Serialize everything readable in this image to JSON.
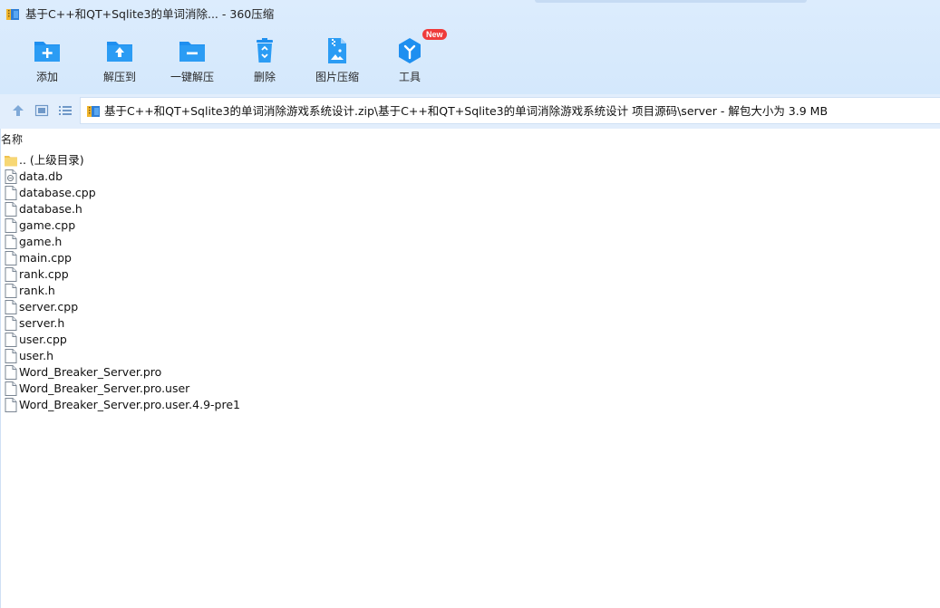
{
  "window": {
    "title": "基于C++和QT+Sqlite3的单词消除... - 360压缩"
  },
  "toolbar": {
    "items": [
      {
        "label": "添加",
        "icon": "add-folder-icon"
      },
      {
        "label": "解压到",
        "icon": "extract-to-folder-icon"
      },
      {
        "label": "一键解压",
        "icon": "one-click-extract-icon"
      },
      {
        "label": "删除",
        "icon": "recycle-bin-icon"
      },
      {
        "label": "图片压缩",
        "icon": "image-compress-icon"
      },
      {
        "label": "工具",
        "icon": "tools-icon",
        "badge": "New"
      }
    ]
  },
  "address": {
    "path": "基于C++和QT+Sqlite3的单词消除游戏系统设计.zip\\基于C++和QT+Sqlite3的单词消除游戏系统设计 项目源码\\server - 解包大小为 3.9 MB"
  },
  "list": {
    "column_name": "名称",
    "files": [
      {
        "name": ".. (上级目录)",
        "type": "folder-up"
      },
      {
        "name": "data.db",
        "type": "db"
      },
      {
        "name": "database.cpp",
        "type": "file"
      },
      {
        "name": "database.h",
        "type": "file"
      },
      {
        "name": "game.cpp",
        "type": "file"
      },
      {
        "name": "game.h",
        "type": "file"
      },
      {
        "name": "main.cpp",
        "type": "file"
      },
      {
        "name": "rank.cpp",
        "type": "file"
      },
      {
        "name": "rank.h",
        "type": "file"
      },
      {
        "name": "server.cpp",
        "type": "file"
      },
      {
        "name": "server.h",
        "type": "file"
      },
      {
        "name": "user.cpp",
        "type": "file"
      },
      {
        "name": "user.h",
        "type": "file"
      },
      {
        "name": "Word_Breaker_Server.pro",
        "type": "file"
      },
      {
        "name": "Word_Breaker_Server.pro.user",
        "type": "file"
      },
      {
        "name": "Word_Breaker_Server.pro.user.4.9-pre1",
        "type": "file"
      }
    ]
  },
  "colors": {
    "accent_blue": "#1e8ff0",
    "chrome_bg": "#dcecfd",
    "badge_red": "#ef3b3b",
    "folder_yellow": "#f7d774"
  }
}
